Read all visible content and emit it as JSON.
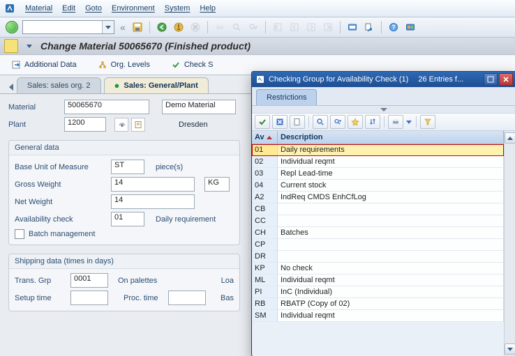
{
  "menu": {
    "items": [
      "Material",
      "Edit",
      "Goto",
      "Environment",
      "System",
      "Help"
    ]
  },
  "title": "Change Material 50065670 (Finished product)",
  "actions": {
    "additional_data": "Additional Data",
    "org_levels": "Org. Levels",
    "check": "Check S"
  },
  "tabs": {
    "left": "Sales: sales org. 2",
    "active": "Sales: General/Plant"
  },
  "header": {
    "material_label": "Material",
    "material": "50065670",
    "material_desc": "Demo Material",
    "plant_label": "Plant",
    "plant": "1200",
    "plant_desc": "Dresden"
  },
  "group_general": {
    "title": "General data",
    "uom_label": "Base Unit of Measure",
    "uom": "ST",
    "uom_text": "piece(s)",
    "gw_label": "Gross Weight",
    "gw": "14",
    "gw_unit": "KG",
    "nw_label": "Net Weight",
    "nw": "14",
    "av_label": "Availability check",
    "av": "01",
    "av_text": "Daily requirement",
    "batch_label": "Batch management"
  },
  "group_shipping": {
    "title": "Shipping data (times in days)",
    "tg_label": "Trans. Grp",
    "tg": "0001",
    "tg_text": "On palettes",
    "loa": "Loa",
    "setup_label": "Setup time",
    "proc_label": "Proc. time",
    "bas": "Bas"
  },
  "modal": {
    "title": "Checking Group for Availability Check (1)",
    "subtitle": "26 Entries f...",
    "tab": "Restrictions",
    "col1": "Av",
    "col2": "Description",
    "rows": [
      {
        "k": "01",
        "d": "Daily requirements",
        "sel": true
      },
      {
        "k": "02",
        "d": "Individual reqmt"
      },
      {
        "k": "03",
        "d": "Repl Lead-time"
      },
      {
        "k": "04",
        "d": "Current stock"
      },
      {
        "k": "A2",
        "d": "IndReq CMDS EnhCfLog"
      },
      {
        "k": "CB",
        "d": ""
      },
      {
        "k": "CC",
        "d": ""
      },
      {
        "k": "CH",
        "d": "Batches"
      },
      {
        "k": "CP",
        "d": ""
      },
      {
        "k": "DR",
        "d": ""
      },
      {
        "k": "KP",
        "d": "No check"
      },
      {
        "k": "ML",
        "d": "Individual reqmt"
      },
      {
        "k": "PI",
        "d": "InC (Individual)"
      },
      {
        "k": "RB",
        "d": "RBATP (Copy of 02)"
      },
      {
        "k": "SM",
        "d": "Individual reqmt"
      }
    ]
  }
}
